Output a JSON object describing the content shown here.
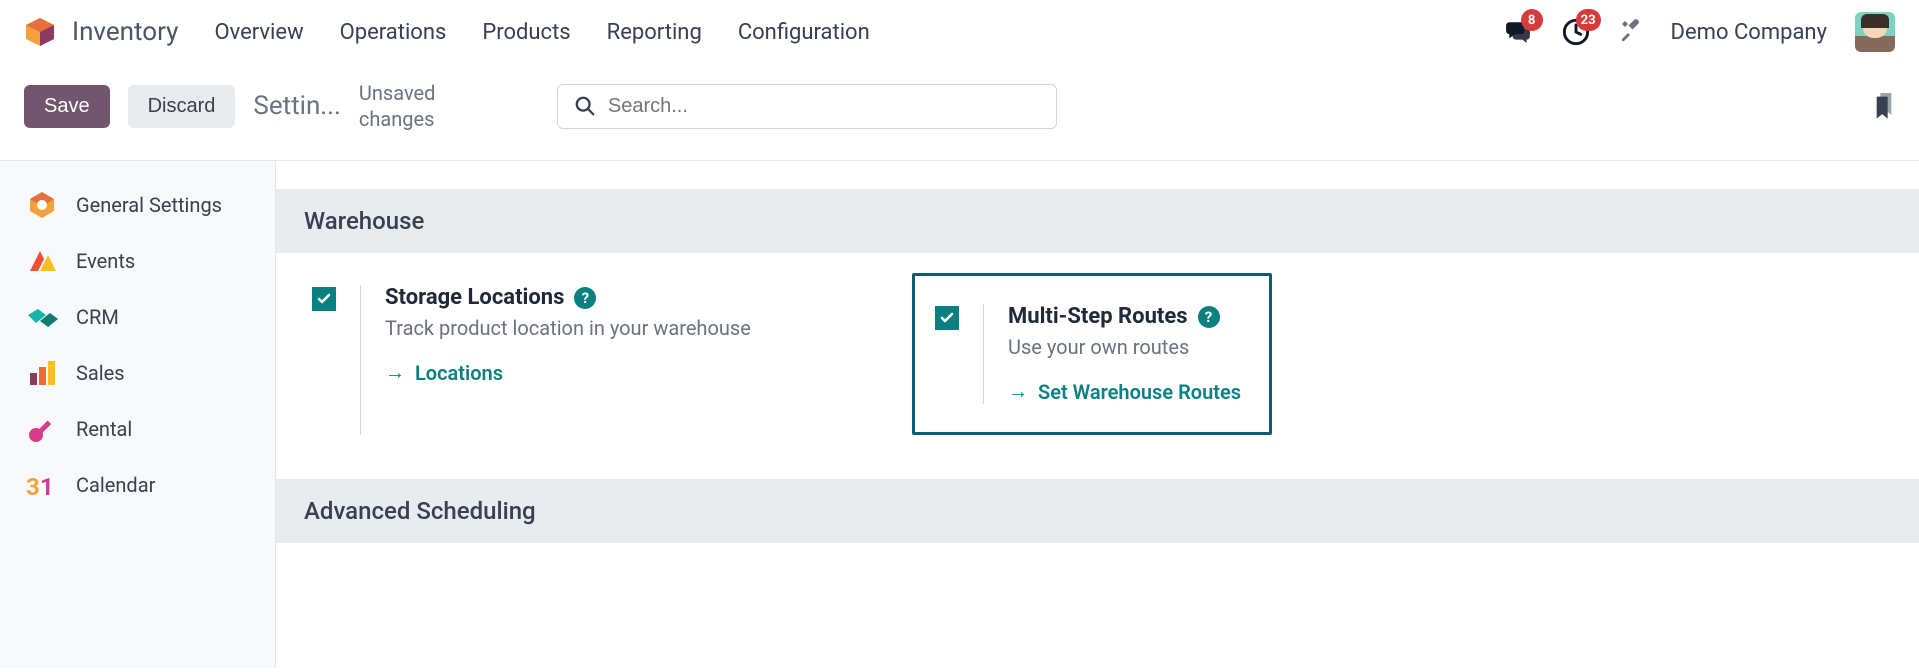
{
  "topnav": {
    "app_name": "Inventory",
    "links": [
      "Overview",
      "Operations",
      "Products",
      "Reporting",
      "Configuration"
    ],
    "messages_badge": "8",
    "activities_badge": "23",
    "company": "Demo Company"
  },
  "actionbar": {
    "save_label": "Save",
    "discard_label": "Discard",
    "breadcrumb": "Settin...",
    "status": "Unsaved changes",
    "search_placeholder": "Search..."
  },
  "sidebar": {
    "items": [
      {
        "label": "General Settings"
      },
      {
        "label": "Events"
      },
      {
        "label": "CRM"
      },
      {
        "label": "Sales"
      },
      {
        "label": "Rental"
      },
      {
        "label": "Calendar"
      }
    ]
  },
  "content": {
    "sections": [
      {
        "title": "Warehouse",
        "settings": [
          {
            "checked": true,
            "title": "Storage Locations",
            "desc": "Track product location in your warehouse",
            "link": "Locations",
            "highlighted": false
          },
          {
            "checked": true,
            "title": "Multi-Step Routes",
            "desc": "Use your own routes",
            "link": "Set Warehouse Routes",
            "highlighted": true
          }
        ]
      },
      {
        "title": "Advanced Scheduling",
        "settings": []
      }
    ]
  }
}
